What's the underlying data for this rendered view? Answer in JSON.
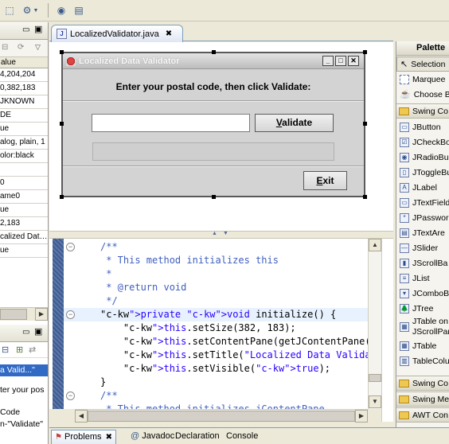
{
  "toolbar": {
    "icons": [
      "select-icon",
      "gear-dropdown-icon",
      "run-icon",
      "outline-icon"
    ]
  },
  "properties": {
    "column_header": "alue",
    "rows": [
      "4,204,204",
      "0,382,183",
      "JKNOWN",
      "DE",
      "ue",
      "alog, plain, 1",
      "olor:black",
      "",
      "0",
      "ame0",
      "ue",
      "2,183",
      "calized Dat…",
      "ue"
    ]
  },
  "lower_panel": {
    "selected_item": "a Valid...\"",
    "lines": [
      "ter your pos",
      "Code",
      "n-\"Validate\""
    ]
  },
  "editor": {
    "tab_label": "LocalizedValidator.java",
    "close_glyph": "✖"
  },
  "dialog": {
    "title": "Localized Data Validator",
    "prompt": "Enter your postal code, then click Validate:",
    "postal_value": "",
    "validate_label": "Validate",
    "validate_mnemonic": "V",
    "result_value": "",
    "exit_label": "Exit",
    "exit_mnemonic": "E"
  },
  "code": {
    "lines": [
      "/**",
      " * This method initializes this",
      " *",
      " * @return void",
      " */",
      "private void initialize() {",
      "    this.setSize(382, 183);",
      "    this.setContentPane(getJContentPane())",
      "    this.setTitle(\"Localized Data Validato",
      "    this.setVisible(true);",
      "}",
      "/**",
      " * This method initializes jContentPane"
    ]
  },
  "palette": {
    "header": "Palette",
    "tools": [
      "Selection",
      "Marquee",
      "Choose B"
    ],
    "category_swing_components": "Swing Co",
    "components": [
      "JButton",
      "JCheckBo",
      "JRadioBu",
      "JToggleBu",
      "JLabel",
      "JTextField",
      "JPasswor",
      "JTextAre",
      "JSlider",
      "JScrollBa",
      "JList",
      "JComboB",
      "JTree",
      "JTable on JScrollPar",
      "JTable",
      "TableColu"
    ],
    "categories_bottom": [
      "Swing Co",
      "Swing Me",
      "AWT Con"
    ]
  },
  "bottom_tabs": [
    "Problems",
    "Javadoc",
    "Declaration",
    "Console"
  ]
}
